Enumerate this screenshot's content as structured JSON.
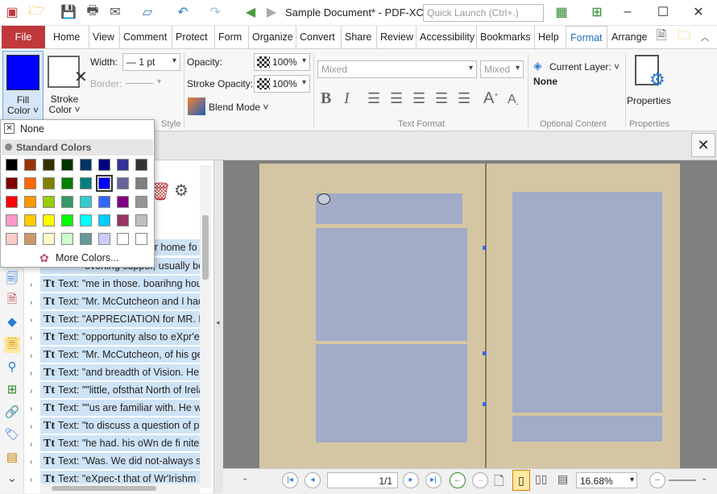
{
  "window": {
    "title": "Sample Document* - PDF-XCh...",
    "quick_launch_placeholder": "Quick Launch (Ctrl+.)"
  },
  "tabs": {
    "file": "File",
    "items": [
      "Home",
      "View",
      "Comment",
      "Protect",
      "Form",
      "Organize",
      "Convert",
      "Share",
      "Review",
      "Accessibility",
      "Bookmarks",
      "Help",
      "Format",
      "Arrange"
    ]
  },
  "ribbon": {
    "fill_color": "Fill\nColor",
    "fill_color_l1": "Fill",
    "fill_color_l2": "Color",
    "stroke_color_l1": "Stroke",
    "stroke_color_l2": "Color",
    "width_label": "Width:",
    "width_value": "— 1 pt",
    "border_label": "Border:",
    "opacity_label": "Opacity:",
    "opacity_value": "100%",
    "stroke_opacity_label": "Stroke Opacity:",
    "stroke_opacity_value": "100%",
    "blend_mode": "Blend Mode",
    "style_group": "Style",
    "font_family": "Mixed",
    "font_size": "Mixed",
    "text_format_group": "Text Format",
    "current_layer_label": "Current Layer:",
    "current_layer_value": "None",
    "optional_content_group": "Optional Content",
    "properties": "Properties",
    "properties_group": "Properties"
  },
  "fill_color_accent": "#0000ff",
  "color_popup": {
    "none_label": "None",
    "standard_colors_label": "Standard Colors",
    "more_colors": "More Colors...",
    "rows": [
      [
        "#000000",
        "#993300",
        "#333300",
        "#003300",
        "#003366",
        "#000080",
        "#333399",
        "#333333"
      ],
      [
        "#800000",
        "#ff6600",
        "#808000",
        "#008000",
        "#008080",
        "#0000ff",
        "#666699",
        "#808080"
      ],
      [
        "#ff0000",
        "#ff9900",
        "#99cc00",
        "#339966",
        "#33cccc",
        "#3366ff",
        "#800080",
        "#969696"
      ],
      [
        "#ff99cc",
        "#ffcc00",
        "#ffff00",
        "#00ff00",
        "#00ffff",
        "#00ccff",
        "#993366",
        "#c0c0c0"
      ],
      [
        "#ffcccc",
        "#cc9966",
        "#ffffcc",
        "#ccffcc",
        "#669999",
        "#ccccff",
        "#ffffff",
        "#ffffff"
      ]
    ]
  },
  "panel": {
    "partial_rows": [
      "eir home fo",
      "evening supper, usually bot"
    ],
    "rows": [
      {
        "type": "Tt",
        "text": "Text: \"me in those. boarihng hous"
      },
      {
        "type": "Tt",
        "text": "Text: \"Mr. McCutcheon and I had"
      },
      {
        "type": "Tt",
        "text": "Text: \"APPRECIATION for MR. MC"
      },
      {
        "type": "Tt",
        "text": "Text: \"opportunity also to eXpr'ess"
      },
      {
        "type": "Tt",
        "text": "Text: \"Mr. McCutcheon, of his ger"
      },
      {
        "type": "Tt",
        "text": "Text: \"and breadth of Vision. He h"
      },
      {
        "type": "Tt",
        "text": "Text: \"\"little, ofsthat North of Irelar"
      },
      {
        "type": "Tt",
        "text": "Text: \"\"us are familiar with. He wa"
      },
      {
        "type": "Tt",
        "text": "Text: \"to discuss a question of pol"
      },
      {
        "type": "Tt",
        "text": "Text: \"he had. his oWn de fi nite O"
      },
      {
        "type": "Tt",
        "text": "Text: \"Was. We did not-always se"
      },
      {
        "type": "Tt",
        "text": "Text: \"eXpec-t that of Wr'Irishm"
      }
    ]
  },
  "status": {
    "page": "1/1",
    "zoom": "16.68%"
  }
}
